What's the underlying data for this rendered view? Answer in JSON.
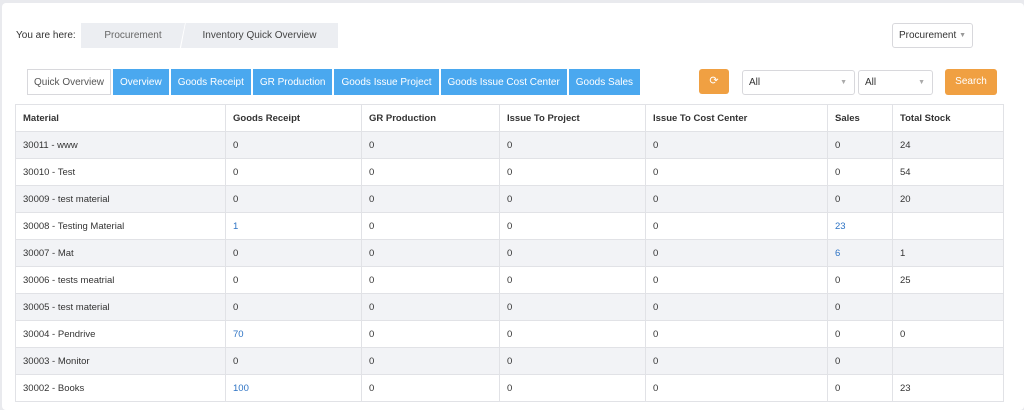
{
  "breadcrumb": {
    "label": "You are here:",
    "items": [
      "Procurement",
      "Inventory Quick Overview"
    ]
  },
  "module_select": {
    "value": "Procurement"
  },
  "tabs": [
    "Quick Overview",
    "Overview",
    "Goods Receipt",
    "GR Production",
    "Goods Issue Project",
    "Goods Issue Cost Center",
    "Goods Sales"
  ],
  "filters": {
    "select1": "All",
    "select2": "All",
    "search_label": "Search"
  },
  "table": {
    "headers": [
      "Material",
      "Goods Receipt",
      "GR Production",
      "Issue To Project",
      "Issue To Cost Center",
      "Sales",
      "Total Stock"
    ],
    "rows": [
      [
        "30011 - www",
        "0",
        "0",
        "0",
        "0",
        "0",
        "24"
      ],
      [
        "30010 - Test",
        "0",
        "0",
        "0",
        "0",
        "0",
        "54"
      ],
      [
        "30009 - test material",
        "0",
        "0",
        "0",
        "0",
        "0",
        "20"
      ],
      [
        "30008 - Testing Material",
        "1",
        "0",
        "0",
        "0",
        "23",
        ""
      ],
      [
        "30007 - Mat",
        "0",
        "0",
        "0",
        "0",
        "6",
        "1"
      ],
      [
        "30006 - tests meatrial",
        "0",
        "0",
        "0",
        "0",
        "0",
        "25"
      ],
      [
        "30005 - test material",
        "0",
        "0",
        "0",
        "0",
        "0",
        ""
      ],
      [
        "30004 - Pendrive",
        "70",
        "0",
        "0",
        "0",
        "0",
        "0"
      ],
      [
        "30003 - Monitor",
        "0",
        "0",
        "0",
        "0",
        "0",
        ""
      ],
      [
        "30002 - Books",
        "100",
        "0",
        "0",
        "0",
        "0",
        "23"
      ]
    ]
  },
  "colors": {
    "tab_blue": "#4aa8ef",
    "orange": "#f0a042",
    "link": "#2d73c4"
  }
}
